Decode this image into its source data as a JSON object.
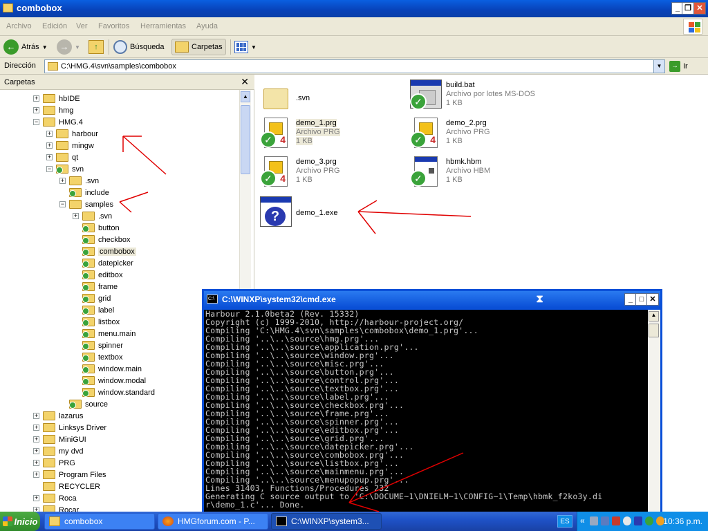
{
  "window": {
    "title": "combobox"
  },
  "menu": [
    "Archivo",
    "Edición",
    "Ver",
    "Favoritos",
    "Herramientas",
    "Ayuda"
  ],
  "toolbar": {
    "back": "Atrás",
    "search": "Búsqueda",
    "folders": "Carpetas"
  },
  "address": {
    "label": "Dirección",
    "path": "C:\\HMG.4\\svn\\samples\\combobox",
    "go": "Ir"
  },
  "folders_pane": {
    "title": "Carpetas",
    "tree": [
      {
        "label": "hbIDE",
        "depth": 0,
        "exp": "+",
        "shared": false
      },
      {
        "label": "hmg",
        "depth": 0,
        "exp": "+",
        "shared": false
      },
      {
        "label": "HMG.4",
        "depth": 0,
        "exp": "-",
        "shared": false
      },
      {
        "label": "harbour",
        "depth": 1,
        "exp": "+",
        "shared": false
      },
      {
        "label": "mingw",
        "depth": 1,
        "exp": "+",
        "shared": false
      },
      {
        "label": "qt",
        "depth": 1,
        "exp": "+",
        "shared": false
      },
      {
        "label": "svn",
        "depth": 1,
        "exp": "-",
        "shared": true
      },
      {
        "label": ".svn",
        "depth": 2,
        "exp": "+",
        "shared": false
      },
      {
        "label": "include",
        "depth": 2,
        "exp": "",
        "shared": true
      },
      {
        "label": "samples",
        "depth": 2,
        "exp": "-",
        "shared": false
      },
      {
        "label": ".svn",
        "depth": 3,
        "exp": "+",
        "shared": false
      },
      {
        "label": "button",
        "depth": 3,
        "exp": "",
        "shared": true
      },
      {
        "label": "checkbox",
        "depth": 3,
        "exp": "",
        "shared": true
      },
      {
        "label": "combobox",
        "depth": 3,
        "exp": "",
        "shared": true,
        "selected": true
      },
      {
        "label": "datepicker",
        "depth": 3,
        "exp": "",
        "shared": true
      },
      {
        "label": "editbox",
        "depth": 3,
        "exp": "",
        "shared": true
      },
      {
        "label": "frame",
        "depth": 3,
        "exp": "",
        "shared": true
      },
      {
        "label": "grid",
        "depth": 3,
        "exp": "",
        "shared": true
      },
      {
        "label": "label",
        "depth": 3,
        "exp": "",
        "shared": true
      },
      {
        "label": "listbox",
        "depth": 3,
        "exp": "",
        "shared": true
      },
      {
        "label": "menu.main",
        "depth": 3,
        "exp": "",
        "shared": true
      },
      {
        "label": "spinner",
        "depth": 3,
        "exp": "",
        "shared": true
      },
      {
        "label": "textbox",
        "depth": 3,
        "exp": "",
        "shared": true
      },
      {
        "label": "window.main",
        "depth": 3,
        "exp": "",
        "shared": true
      },
      {
        "label": "window.modal",
        "depth": 3,
        "exp": "",
        "shared": true
      },
      {
        "label": "window.standard",
        "depth": 3,
        "exp": "",
        "shared": true
      },
      {
        "label": "source",
        "depth": 2,
        "exp": "",
        "shared": true
      },
      {
        "label": "lazarus",
        "depth": 0,
        "exp": "+",
        "shared": false
      },
      {
        "label": "Linksys Driver",
        "depth": 0,
        "exp": "+",
        "shared": false
      },
      {
        "label": "MiniGUI",
        "depth": 0,
        "exp": "+",
        "shared": false
      },
      {
        "label": "my dvd",
        "depth": 0,
        "exp": "+",
        "shared": false
      },
      {
        "label": "PRG",
        "depth": 0,
        "exp": "+",
        "shared": false
      },
      {
        "label": "Program Files",
        "depth": 0,
        "exp": "+",
        "shared": false
      },
      {
        "label": "RECYCLER",
        "depth": 0,
        "exp": "",
        "shared": false
      },
      {
        "label": "Roca",
        "depth": 0,
        "exp": "+",
        "shared": false
      },
      {
        "label": "Rocar",
        "depth": 0,
        "exp": "+",
        "shared": false
      }
    ]
  },
  "files": [
    {
      "name": ".svn",
      "type": "",
      "size": "",
      "icon": "folder-icon"
    },
    {
      "name": "build.bat",
      "type": "Archivo por lotes MS-DOS",
      "size": "1 KB",
      "icon": "batch-file-icon"
    },
    {
      "name": "demo_1.prg",
      "type": "Archivo PRG",
      "size": "1 KB",
      "icon": "prg-file-icon",
      "selected": true
    },
    {
      "name": "demo_2.prg",
      "type": "Archivo PRG",
      "size": "1 KB",
      "icon": "prg-file-icon"
    },
    {
      "name": "demo_3.prg",
      "type": "Archivo PRG",
      "size": "1 KB",
      "icon": "prg-file-icon"
    },
    {
      "name": "hbmk.hbm",
      "type": "Archivo HBM",
      "size": "1 KB",
      "icon": "hbm-file-icon"
    },
    {
      "name": "demo_1.exe",
      "type": "",
      "size": "",
      "icon": "exe-file-icon"
    }
  ],
  "cmd": {
    "title": "C:\\WINXP\\system32\\cmd.exe",
    "lines": [
      "Harbour 2.1.0beta2 (Rev. 15332)",
      "Copyright (c) 1999-2010, http://harbour-project.org/",
      "Compiling 'C:\\HMG.4\\svn\\samples\\combobox\\demo_1.prg'...",
      "Compiling '..\\..\\source\\hmg.prg'...",
      "Compiling '..\\..\\source\\application.prg'...",
      "Compiling '..\\..\\source\\window.prg'...",
      "Compiling '..\\..\\source\\misc.prg'...",
      "Compiling '..\\..\\source\\button.prg'...",
      "Compiling '..\\..\\source\\control.prg'...",
      "Compiling '..\\..\\source\\textbox.prg'...",
      "Compiling '..\\..\\source\\label.prg'...",
      "Compiling '..\\..\\source\\checkbox.prg'...",
      "Compiling '..\\..\\source\\frame.prg'...",
      "Compiling '..\\..\\source\\spinner.prg'...",
      "Compiling '..\\..\\source\\editbox.prg'...",
      "Compiling '..\\..\\source\\grid.prg'...",
      "Compiling '..\\..\\source\\datepicker.prg'...",
      "Compiling '..\\..\\source\\combobox.prg'...",
      "Compiling '..\\..\\source\\listbox.prg'...",
      "Compiling '..\\..\\source\\mainmenu.prg'...",
      "Compiling '..\\..\\source\\menupopup.prg'...",
      "Lines 31403, Functions/Procedures 232",
      "Generating C source output to 'C:\\DOCUME~1\\DNIELM~1\\CONFIG~1\\Temp\\hbmk_f2ko3y.di",
      "r\\demo_1.c'... Done."
    ]
  },
  "taskbar": {
    "start": "Inicio",
    "tasks": [
      "combobox",
      "HMGforum.com - P...",
      "C:\\WINXP\\system3..."
    ],
    "lang": "ES",
    "clock": "10:36 p.m."
  },
  "colors": {
    "title_blue": "#0a5fe0",
    "xp_beige": "#ece9d8",
    "annotation_red": "#e00000"
  }
}
